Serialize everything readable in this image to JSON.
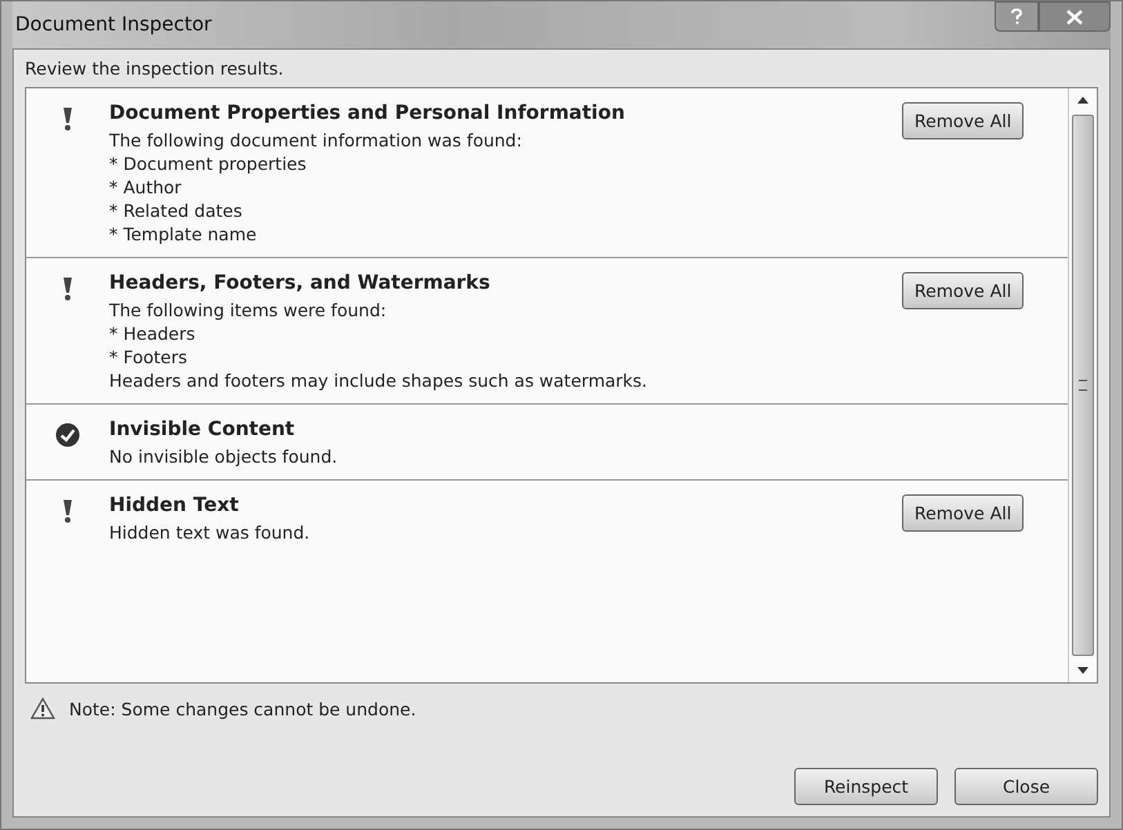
{
  "window": {
    "title": "Document Inspector"
  },
  "instruction": "Review the inspection results.",
  "sections": [
    {
      "kind": "found",
      "title": "Document Properties and Personal Information",
      "lines": [
        "The following document information was found:",
        "* Document properties",
        "* Author",
        "* Related dates",
        "* Template name"
      ],
      "button": "Remove All"
    },
    {
      "kind": "found",
      "title": "Headers, Footers, and Watermarks",
      "lines": [
        "The following items were found:",
        "* Headers",
        "* Footers",
        "Headers and footers may include shapes such as watermarks."
      ],
      "button": "Remove All"
    },
    {
      "kind": "clean",
      "title": "Invisible Content",
      "lines": [
        "No invisible objects found."
      ]
    },
    {
      "kind": "found",
      "title": "Hidden Text",
      "lines": [
        "Hidden text was found."
      ],
      "button": "Remove All"
    }
  ],
  "note": "Note: Some changes cannot be undone.",
  "buttons": [
    "Reinspect",
    "Close"
  ]
}
